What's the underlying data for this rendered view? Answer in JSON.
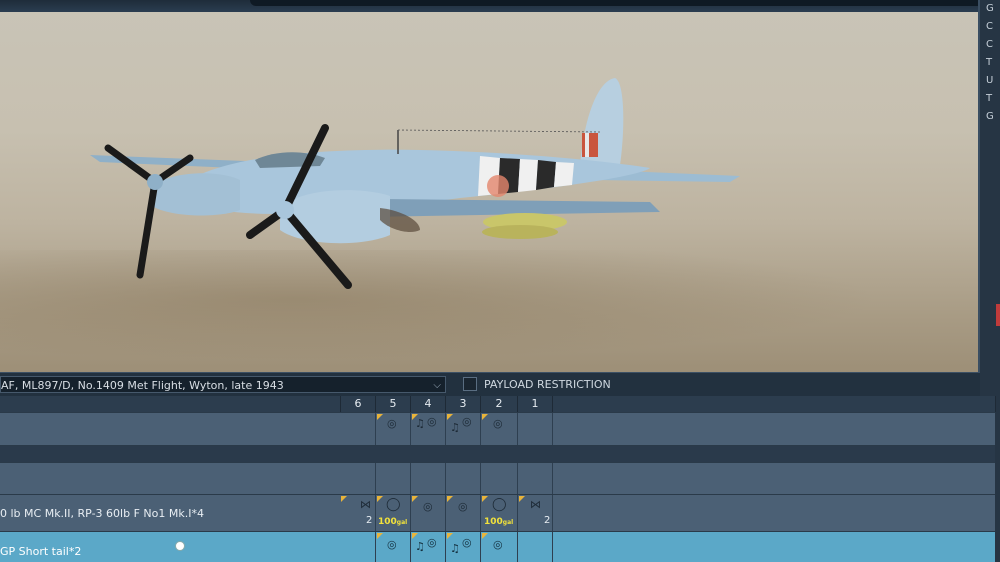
{
  "livery": {
    "selected": "AF, ML897/D, No.1409 Met Flight, Wyton, late 1943"
  },
  "payload_restriction": {
    "label": "PAYLOAD RESTRICTION",
    "checked": false
  },
  "stations": [
    "6",
    "5",
    "4",
    "3",
    "2",
    "1"
  ],
  "loadouts": [
    {
      "label": "0 lb MC Mk.II, RP-3 60lb F No1 Mk.I*4",
      "count_left": "2",
      "count_right": "2",
      "tag": "100",
      "tag_unit": "gal"
    },
    {
      "label": "GP Short tail*2"
    }
  ],
  "right_panel": [
    "G",
    "C",
    "C",
    "T",
    "U",
    "T",
    "G"
  ],
  "colors": {
    "accent_orange": "#e9b43a",
    "selected_row": "#5ba8c8",
    "panel_dark": "#22313f",
    "fuel_label": "#f2e23b"
  },
  "icons": [
    "chevron-down-icon",
    "checkbox-icon",
    "bomb-icon",
    "rocket-icon",
    "drop-tank-icon",
    "radio-icon"
  ]
}
